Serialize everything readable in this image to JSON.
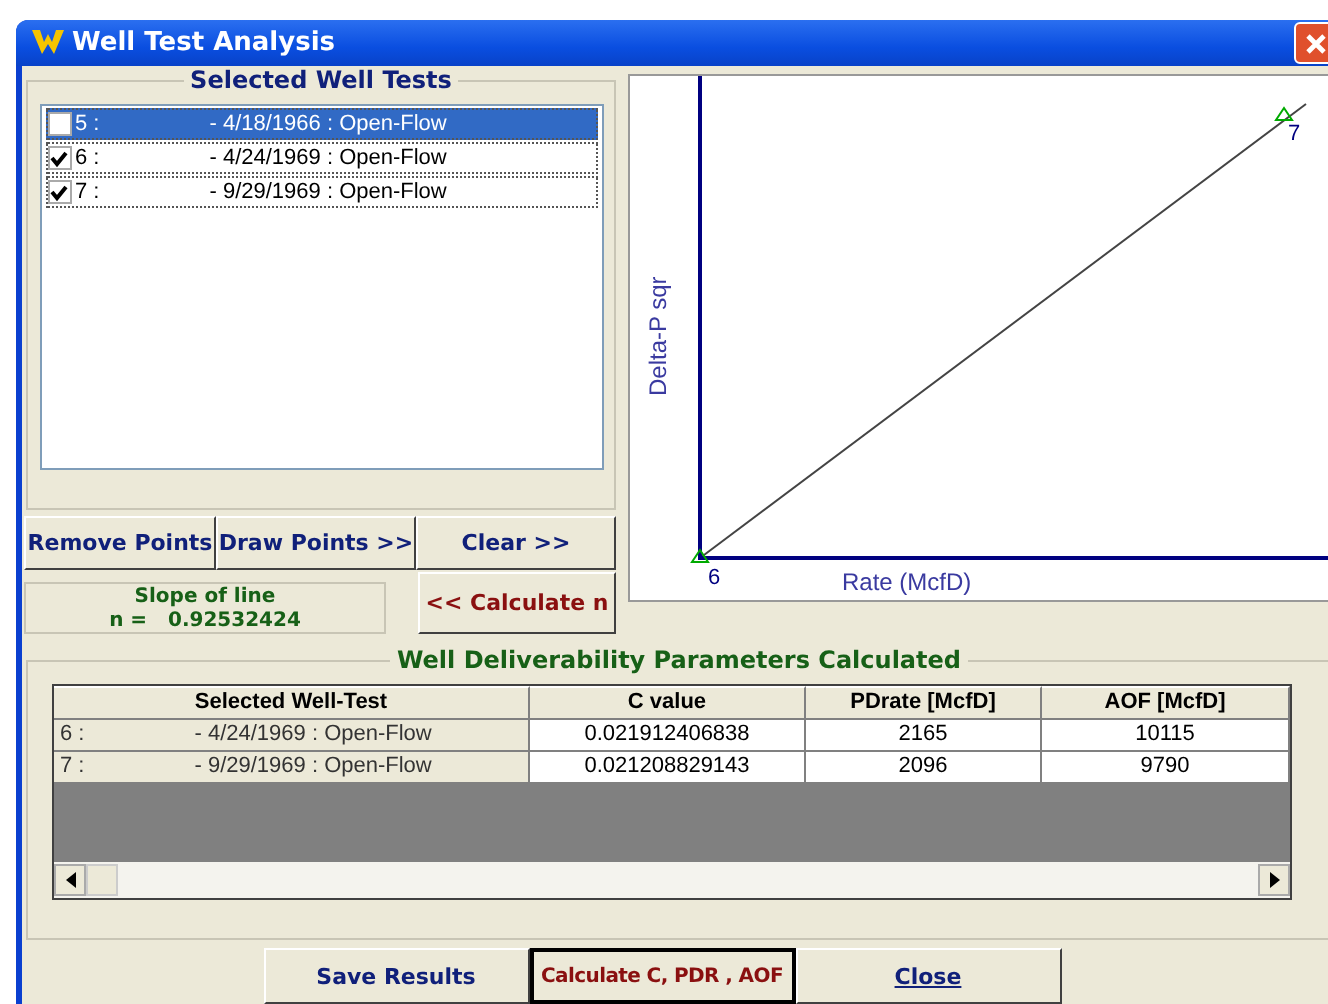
{
  "window": {
    "title": "Well Test Analysis"
  },
  "well_tests": {
    "title": "Selected Well Tests",
    "items": [
      {
        "label": "5 :                  - 4/18/1966 : Open-Flow",
        "checked": false,
        "selected": true
      },
      {
        "label": "6 :                  - 4/24/1969 : Open-Flow",
        "checked": true,
        "selected": false
      },
      {
        "label": "7 :                  - 9/29/1969 : Open-Flow",
        "checked": true,
        "selected": false
      }
    ]
  },
  "point_buttons": [
    "Remove Points",
    "Draw Points >>",
    "Clear >>"
  ],
  "slope": {
    "label": "Slope of line",
    "prefix": "n =",
    "value": "0.92532424"
  },
  "calculate_n": "<< Calculate n",
  "plot": {
    "ylabel": "Delta-P sqr",
    "xlabel": "Rate (McfD)",
    "points": [
      "6",
      "7"
    ]
  },
  "results": {
    "title": "Well Deliverability Parameters Calculated",
    "columns": [
      "Selected Well-Test",
      "C value",
      "PDrate [McfD]",
      "AOF [McfD]"
    ],
    "rows": [
      [
        "6 :                  - 4/24/1969 : Open-Flow",
        "0.021912406838",
        "2165",
        "10115"
      ],
      [
        "7 :                  - 9/29/1969 : Open-Flow",
        "0.021208829143",
        "2096",
        "9790"
      ]
    ]
  },
  "actions": [
    {
      "label": "Save Results",
      "kind": "save"
    },
    {
      "label": "Calculate C, PDR , AOF",
      "kind": "calculate"
    },
    {
      "label": "Close",
      "kind": "close"
    }
  ]
}
